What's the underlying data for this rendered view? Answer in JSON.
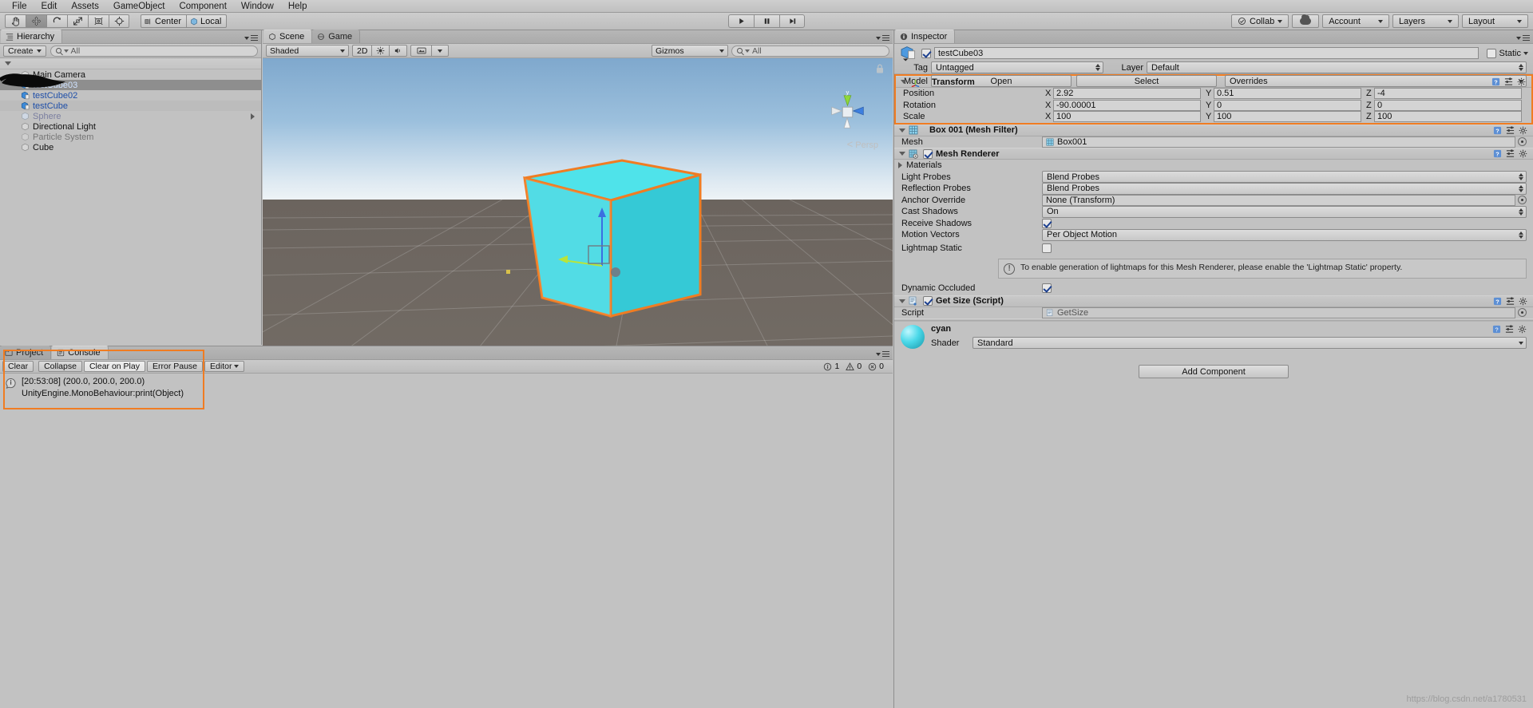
{
  "menubar": {
    "items": [
      "File",
      "Edit",
      "Assets",
      "GameObject",
      "Component",
      "Window",
      "Help"
    ]
  },
  "toolbar": {
    "tools": [
      "hand-tool",
      "move-tool",
      "rotate-tool",
      "scale-tool",
      "rect-tool",
      "transform-tool"
    ],
    "active_tool_index": 1,
    "pivot_label": "Center",
    "space_label": "Local",
    "play_label": "play",
    "pause_label": "pause",
    "step_label": "step",
    "collab_label": "Collab",
    "account_label": "Account",
    "layers_label": "Layers",
    "layout_label": "Layout"
  },
  "hierarchy": {
    "tab_label": "Hierarchy",
    "create_label": "Create",
    "search_placeholder": "All",
    "items": [
      {
        "label": "Main Camera",
        "selected": false,
        "dim": false,
        "prefab": false
      },
      {
        "label": "testCube03",
        "selected": true,
        "dim": false,
        "prefab": true
      },
      {
        "label": "testCube02",
        "selected": false,
        "dim": false,
        "prefab": true
      },
      {
        "label": "testCube",
        "selected": false,
        "dim": false,
        "prefab": true
      },
      {
        "label": "Sphere",
        "selected": false,
        "dim": true,
        "prefab": false
      },
      {
        "label": "Directional Light",
        "selected": false,
        "dim": false,
        "prefab": false
      },
      {
        "label": "Particle System",
        "selected": false,
        "dim": true,
        "prefab": false
      },
      {
        "label": "Cube",
        "selected": false,
        "dim": false,
        "prefab": false
      }
    ]
  },
  "scene": {
    "tabs": [
      {
        "label": "Scene",
        "active": true
      },
      {
        "label": "Game",
        "active": false
      }
    ],
    "shading_label": "Shaded",
    "mode_2d_label": "2D",
    "gizmos_label": "Gizmos",
    "gizmos_search_placeholder": "All",
    "perspective_label": "Persp",
    "gizmo_axis_label": "y"
  },
  "inspector": {
    "tab_label": "Inspector",
    "object_name": "testCube03",
    "object_enabled": true,
    "static_label": "Static",
    "tag_label": "Tag",
    "tag_value": "Untagged",
    "layer_label": "Layer",
    "layer_value": "Default",
    "model_label": "Model",
    "open_label": "Open",
    "select_label": "Select",
    "overrides_label": "Overrides",
    "transform": {
      "title": "Transform",
      "rows": [
        {
          "name": "Position",
          "x": "2.92",
          "y": "0.51",
          "z": "-4"
        },
        {
          "name": "Rotation",
          "x": "-90.00001",
          "y": "0",
          "z": "0"
        },
        {
          "name": "Scale",
          "x": "100",
          "y": "100",
          "z": "100"
        }
      ],
      "axis_labels": [
        "X",
        "Y",
        "Z"
      ]
    },
    "mesh_filter": {
      "title": "Box 001 (Mesh Filter)",
      "mesh_label": "Mesh",
      "mesh_value": "Box001"
    },
    "mesh_renderer": {
      "title": "Mesh Renderer",
      "enabled": true,
      "materials_label": "Materials",
      "light_probes_label": "Light Probes",
      "light_probes_value": "Blend Probes",
      "reflection_probes_label": "Reflection Probes",
      "reflection_probes_value": "Blend Probes",
      "anchor_override_label": "Anchor Override",
      "anchor_override_value": "None (Transform)",
      "cast_shadows_label": "Cast Shadows",
      "cast_shadows_value": "On",
      "receive_shadows_label": "Receive Shadows",
      "receive_shadows_checked": true,
      "motion_vectors_label": "Motion Vectors",
      "motion_vectors_value": "Per Object Motion",
      "lightmap_static_label": "Lightmap Static",
      "lightmap_static_checked": false,
      "help_text": "To enable generation of lightmaps for this Mesh Renderer, please enable the 'Lightmap Static' property.",
      "dynamic_occluded_label": "Dynamic Occluded",
      "dynamic_occluded_checked": true
    },
    "script_component": {
      "title": "Get Size (Script)",
      "enabled": true,
      "script_label": "Script",
      "script_value": "GetSize"
    },
    "material": {
      "name": "cyan",
      "shader_label": "Shader",
      "shader_value": "Standard"
    },
    "add_component_label": "Add Component"
  },
  "console": {
    "tabs": [
      {
        "label": "Project",
        "active": false
      },
      {
        "label": "Console",
        "active": true
      }
    ],
    "buttons": [
      "Clear",
      "Collapse",
      "Clear on Play",
      "Error Pause",
      "Editor"
    ],
    "counts": {
      "info": "1",
      "warning": "0",
      "error": "0"
    },
    "entries": [
      {
        "line1": "[20:53:08] (200.0, 200.0, 200.0)",
        "line2": "UnityEngine.MonoBehaviour:print(Object)"
      }
    ]
  },
  "watermark": "https://blog.csdn.net/a1780531",
  "colors": {
    "highlight_orange": "#f07c22",
    "panel_bg": "#c2c2c2",
    "selection": "#8e8e8e",
    "cube_cyan": "#3fe0e8",
    "prefab_blue": "#1f4fa8"
  }
}
